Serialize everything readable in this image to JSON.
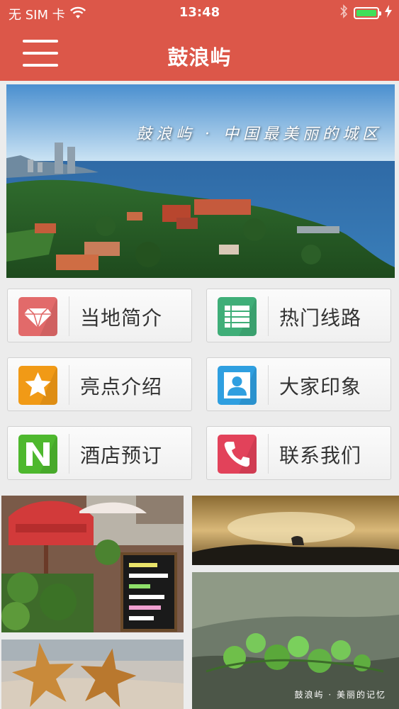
{
  "status_bar": {
    "carrier": "无 SIM 卡",
    "time": "13:48",
    "battery_level": 1.0,
    "icons": [
      "wifi-icon",
      "bluetooth-icon",
      "battery-icon",
      "charging-icon"
    ]
  },
  "nav": {
    "title": "鼓浪屿",
    "menu_icon": "hamburger-menu-icon"
  },
  "banner": {
    "caption": "鼓浪屿 · 中国最美丽的城区"
  },
  "menu": [
    {
      "label": "当地简介",
      "icon": "diamond-icon",
      "color": "#e26a6a"
    },
    {
      "label": "热门线路",
      "icon": "list-icon",
      "color": "#3fae78"
    },
    {
      "label": "亮点介绍",
      "icon": "star-icon",
      "color": "#f19a16"
    },
    {
      "label": "大家印象",
      "icon": "person-icon",
      "color": "#2f9fe0"
    },
    {
      "label": "酒店预订",
      "icon": "n-letter-icon",
      "color": "#4eb82e"
    },
    {
      "label": "联系我们",
      "icon": "phone-icon",
      "color": "#e2425a"
    }
  ],
  "photos": {
    "bottom_right_caption": "鼓浪屿 · 美丽的记忆"
  },
  "colors": {
    "header": "#dc5749",
    "background": "#ececec"
  }
}
